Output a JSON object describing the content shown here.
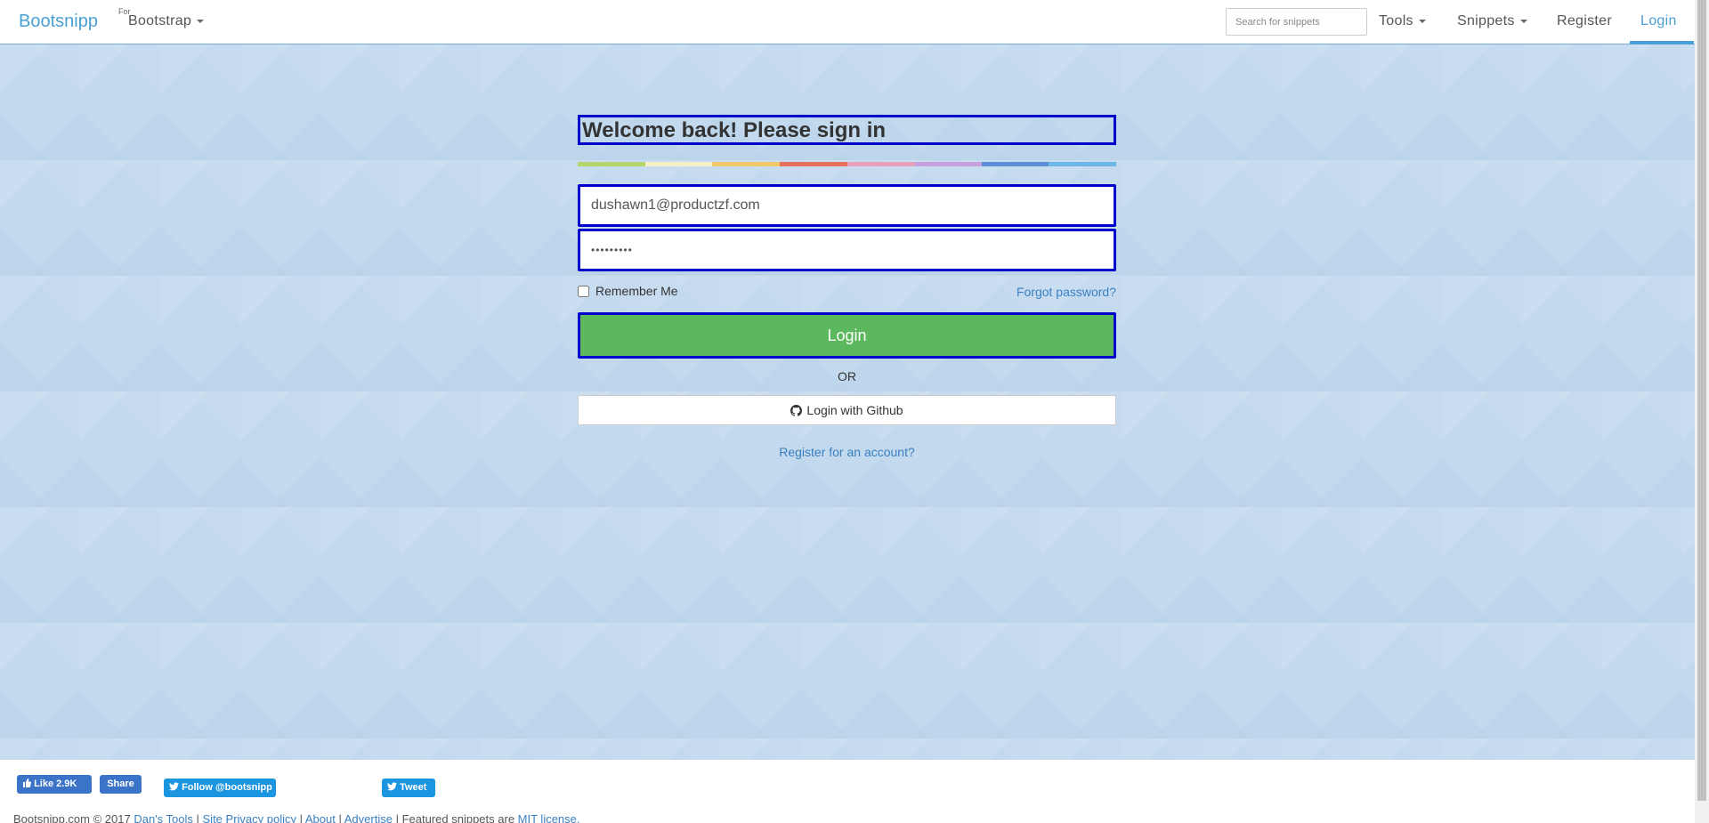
{
  "navbar": {
    "brand": "Bootsnipp",
    "for_label": "For",
    "bootstrap_menu": "Bootstrap",
    "search_placeholder": "Search for snippets",
    "tools": "Tools",
    "snippets": "Snippets",
    "register": "Register",
    "login": "Login"
  },
  "form": {
    "heading": "Welcome back! Please sign in",
    "rainbow_colors": [
      "#b3d66c",
      "#f5f0c8",
      "#f2c96a",
      "#e86f5c",
      "#e9a0b8",
      "#c7a1dd",
      "#5d8fd8",
      "#6cb7e5"
    ],
    "email_value": "dushawn1@productzf.com",
    "password_value": "•••••••••",
    "remember_label": "Remember Me",
    "forgot_label": "Forgot password?",
    "login_button": "Login",
    "or_label": "OR",
    "github_button": "Login with Github",
    "register_link": "Register for an account?"
  },
  "footer": {
    "fb_like": "Like 2.9K",
    "fb_share": "Share",
    "twitter_follow": "Follow @bootsnipp",
    "tweet": "Tweet",
    "copyright": "Bootsnipp.com © 2017",
    "links": [
      "Dan's Tools",
      "Site Privacy policy",
      "About",
      "Advertise"
    ],
    "featured_text": "Featured snippets are",
    "mit_license": "MIT license."
  },
  "colors": {
    "accent": "#4a9fd5",
    "login_green": "#5cb85c",
    "highlight_border": "#0000cc",
    "background": "#c2d9ee"
  }
}
